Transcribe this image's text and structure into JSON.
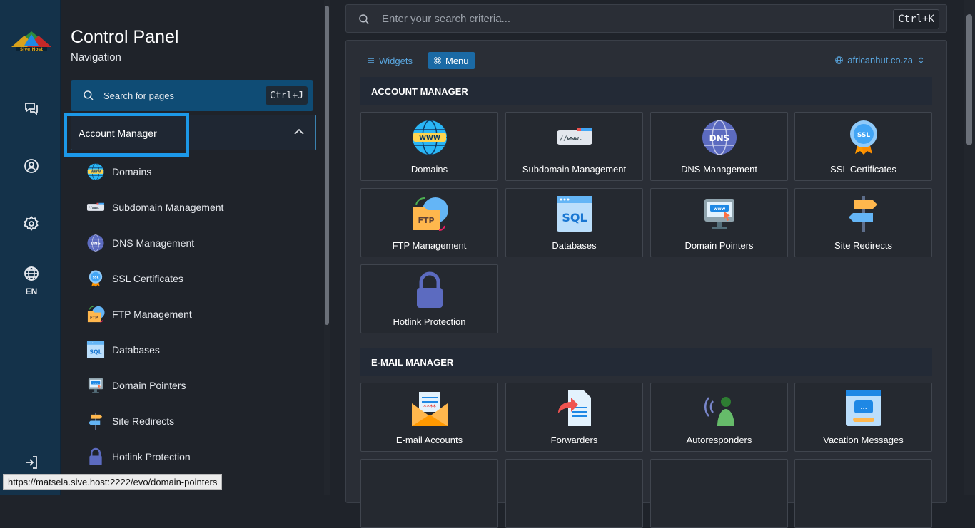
{
  "rail": {
    "logo_text": "Sive.Host",
    "lang": "EN"
  },
  "nav": {
    "title": "Control Panel",
    "subtitle": "Navigation",
    "search_placeholder": "Search for pages",
    "search_shortcut": "Ctrl+J",
    "group_label": "Account Manager",
    "items": [
      {
        "label": "Domains",
        "icon": "www-globe-icon"
      },
      {
        "label": "Subdomain Management",
        "icon": "subdomain-icon"
      },
      {
        "label": "DNS Management",
        "icon": "dns-globe-icon"
      },
      {
        "label": "SSL Certificates",
        "icon": "ssl-badge-icon"
      },
      {
        "label": "FTP Management",
        "icon": "ftp-folder-icon"
      },
      {
        "label": "Databases",
        "icon": "sql-database-icon"
      },
      {
        "label": "Domain Pointers",
        "icon": "domain-pointer-icon"
      },
      {
        "label": "Site Redirects",
        "icon": "signpost-icon"
      },
      {
        "label": "Hotlink Protection",
        "icon": "padlock-icon"
      }
    ]
  },
  "main": {
    "search_placeholder": "Enter your search criteria...",
    "search_shortcut": "Ctrl+K",
    "tab_widgets": "Widgets",
    "tab_menu": "Menu",
    "domain": "africanhut.co.za",
    "sections": [
      {
        "title": "ACCOUNT MANAGER",
        "cards": [
          {
            "label": "Domains"
          },
          {
            "label": "Subdomain Management"
          },
          {
            "label": "DNS Management"
          },
          {
            "label": "SSL Certificates"
          },
          {
            "label": "FTP Management"
          },
          {
            "label": "Databases"
          },
          {
            "label": "Domain Pointers"
          },
          {
            "label": "Site Redirects"
          },
          {
            "label": "Hotlink Protection"
          }
        ]
      },
      {
        "title": "E-MAIL MANAGER",
        "cards": [
          {
            "label": "E-mail Accounts"
          },
          {
            "label": "Forwarders"
          },
          {
            "label": "Autoresponders"
          },
          {
            "label": "Vacation Messages"
          }
        ]
      }
    ]
  },
  "status_url": "https://matsela.sive.host:2222/evo/domain-pointers"
}
